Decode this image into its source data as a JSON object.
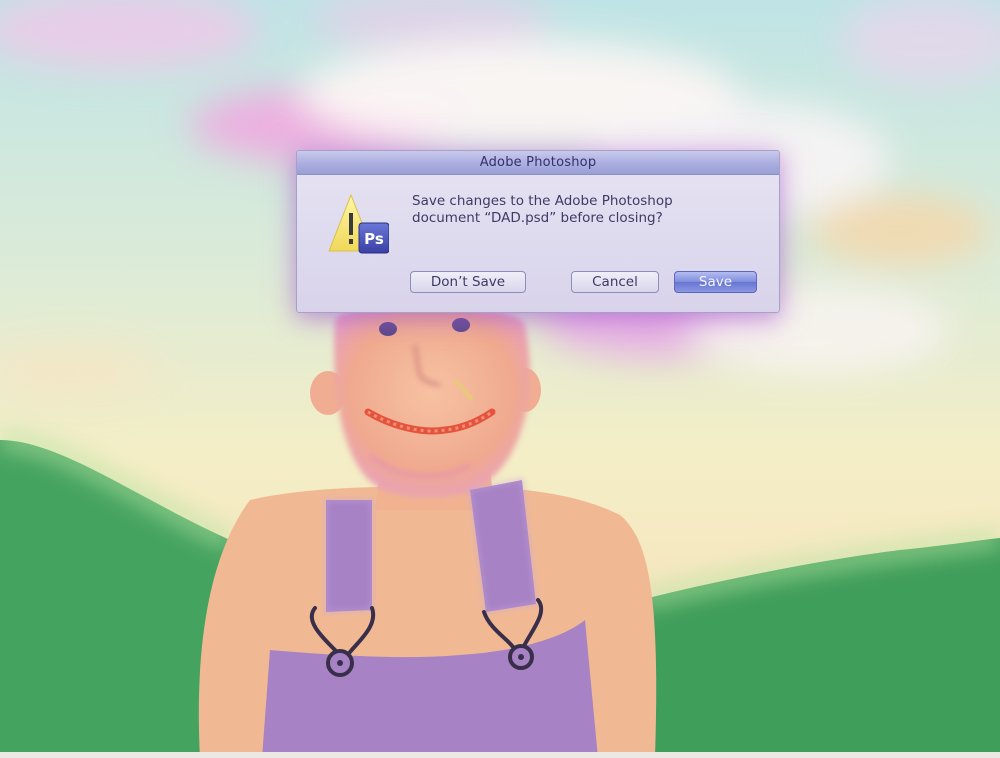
{
  "dialog": {
    "title": "Adobe Photoshop",
    "message_line1": "Save changes to the Adobe Photoshop",
    "message_line2": "document “DAD.psd” before closing?",
    "icon": "photoshop-warning-icon",
    "icon_badge_text": "Ps",
    "buttons": {
      "dont_save": "Don’t Save",
      "cancel": "Cancel",
      "save": "Save"
    },
    "default_button": "save"
  },
  "colors": {
    "title_bar": "#aaaee0",
    "dialog_body": "#dedaee",
    "default_button": "#7f8ddf",
    "grass": "#3f9e5a",
    "overalls": "#a782c4",
    "skin": "#f0b896"
  }
}
